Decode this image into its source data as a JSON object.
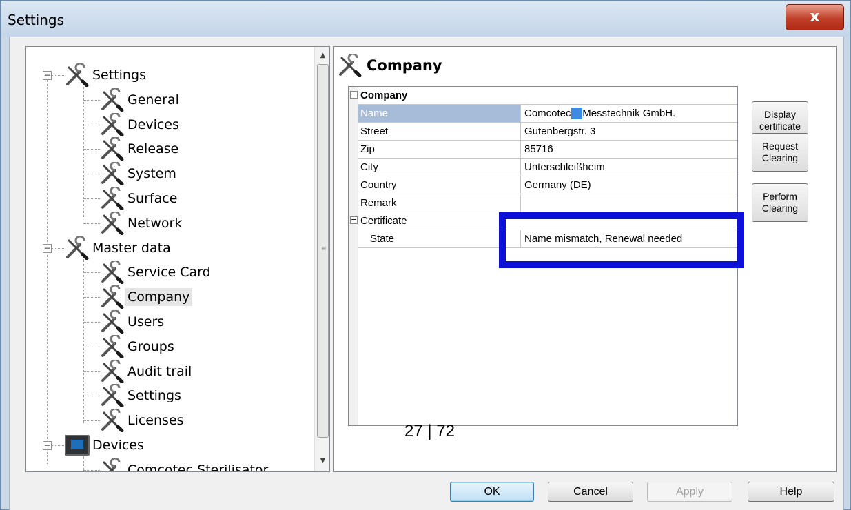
{
  "window": {
    "title": "Settings",
    "close_glyph": "x"
  },
  "tree": {
    "items": [
      {
        "label": "Settings",
        "icon": "tools-icon"
      },
      {
        "label": "General",
        "icon": "tools-icon"
      },
      {
        "label": "Devices",
        "icon": "tools-icon"
      },
      {
        "label": "Release",
        "icon": "tools-icon"
      },
      {
        "label": "System",
        "icon": "tools-icon"
      },
      {
        "label": "Surface",
        "icon": "tools-icon"
      },
      {
        "label": "Network",
        "icon": "tools-icon"
      },
      {
        "label": "Master data",
        "icon": "tools-icon"
      },
      {
        "label": "Service Card",
        "icon": "tools-icon"
      },
      {
        "label": "Company",
        "icon": "tools-icon",
        "selected": true
      },
      {
        "label": "Users",
        "icon": "tools-icon"
      },
      {
        "label": "Groups",
        "icon": "tools-icon"
      },
      {
        "label": "Audit trail",
        "icon": "tools-icon"
      },
      {
        "label": "Settings",
        "icon": "tools-icon"
      },
      {
        "label": "Licenses",
        "icon": "tools-icon"
      },
      {
        "label": "Devices",
        "icon": "device-monitor-icon"
      },
      {
        "label": "Comcotec Sterilisator",
        "icon": "tools-icon"
      }
    ],
    "expander_glyph": "−"
  },
  "company_panel": {
    "header": "Company",
    "grid": {
      "category_company": "Company",
      "rows": [
        {
          "key": "Name",
          "value_a": "Comcotec",
          "value_b": "Messtechnik GmbH."
        },
        {
          "key": "Street",
          "value": "Gutenbergstr. 3"
        },
        {
          "key": "Zip",
          "value": "85716"
        },
        {
          "key": "City",
          "value": "Unterschleißheim"
        },
        {
          "key": "Country",
          "value": "Germany (DE)"
        },
        {
          "key": "Remark",
          "value": ""
        }
      ],
      "category_certificate": "Certificate",
      "state_key": "State",
      "state_value": "Name mismatch, Renewal needed"
    },
    "buttons": {
      "display_certificate": [
        "Display",
        "certificate"
      ],
      "request_clearing": [
        "Request",
        "Clearing"
      ],
      "perform_clearing": [
        "Perform",
        "Clearing"
      ]
    }
  },
  "page_number": "27 | 72",
  "footer": {
    "ok": "OK",
    "cancel": "Cancel",
    "apply": "Apply",
    "help": "Help"
  },
  "colors": {
    "highlight_box": "#0d11d8",
    "selected_row": "#a6bcd9",
    "close_button": "#c2402a"
  }
}
